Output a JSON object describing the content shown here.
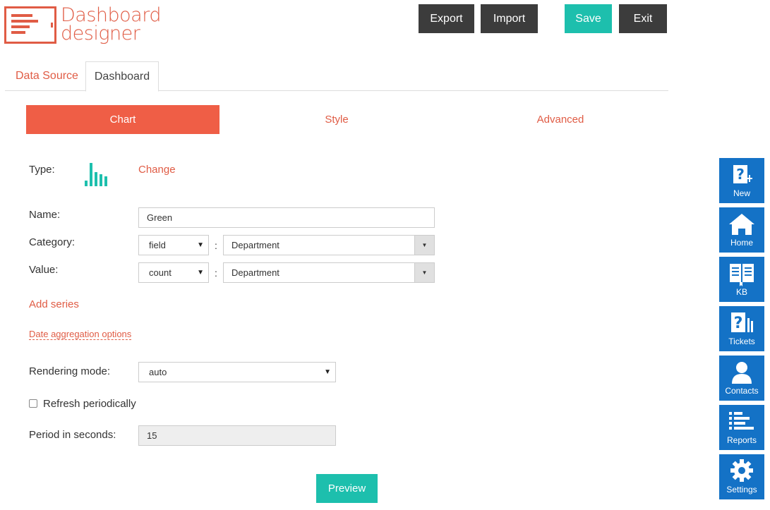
{
  "app": {
    "title_line1": "Dashboard",
    "title_line2": "designer",
    "logo_color": "#e05c45"
  },
  "toolbar": {
    "export_label": "Export",
    "import_label": "Import",
    "save_label": "Save",
    "exit_label": "Exit"
  },
  "main_tabs": [
    {
      "label": "Data Source",
      "active": false
    },
    {
      "label": "Dashboard",
      "active": true
    }
  ],
  "sub_tabs": [
    {
      "label": "Chart",
      "active": true
    },
    {
      "label": "Style",
      "active": false
    },
    {
      "label": "Advanced",
      "active": false
    }
  ],
  "form": {
    "type_label": "Type:",
    "type_icon": "bar-chart-icon",
    "change_link": "Change",
    "name_label": "Name:",
    "name_value": "Green",
    "category_label": "Category:",
    "category_mode": "field",
    "category_field": "Department",
    "value_label": "Value:",
    "value_mode": "count",
    "value_field": "Department",
    "colon": ":",
    "add_series": "Add series",
    "date_aggregation": "Date aggregation options",
    "rendering_label": "Rendering mode:",
    "rendering_value": "auto",
    "refresh_label": "Refresh periodically",
    "refresh_checked": false,
    "period_label": "Period in seconds:",
    "period_value": "15",
    "preview_label": "Preview"
  },
  "sidebar": {
    "items": [
      {
        "label": "New",
        "icon": "new-ticket-icon"
      },
      {
        "label": "Home",
        "icon": "home-icon"
      },
      {
        "label": "KB",
        "icon": "book-icon"
      },
      {
        "label": "Tickets",
        "icon": "tickets-icon"
      },
      {
        "label": "Contacts",
        "icon": "person-icon"
      },
      {
        "label": "Reports",
        "icon": "reports-icon"
      },
      {
        "label": "Settings",
        "icon": "gear-icon"
      }
    ]
  },
  "colors": {
    "accent": "#ef5e46",
    "teal": "#1dbfad",
    "dark": "#3c3c3c",
    "sidebar_blue": "#1472c6"
  }
}
